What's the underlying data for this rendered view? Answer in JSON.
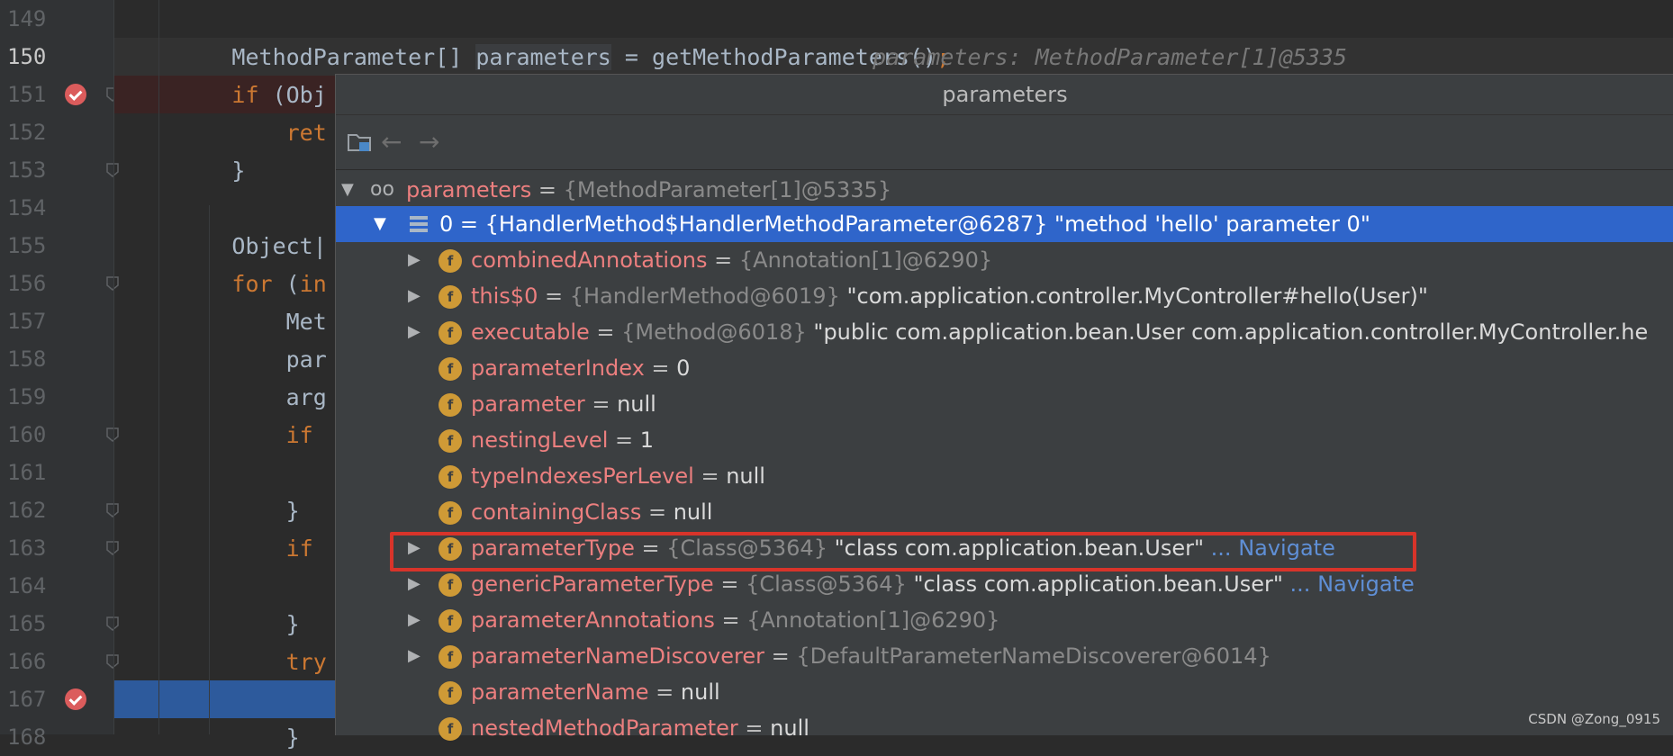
{
  "editor": {
    "lines": [
      {
        "num": "149",
        "code": ""
      },
      {
        "num": "150",
        "code_parts": [
          {
            "t": "        MethodParameter[] ",
            "c": ""
          },
          {
            "t": "parameters",
            "c": "var-hl"
          },
          {
            "t": " = getMethodParameters()",
            "c": ""
          },
          {
            "t": ";",
            "c": "kw"
          }
        ],
        "hint": "  parameters: MethodParameter[1]@5335"
      },
      {
        "num": "151",
        "code_parts": [
          {
            "t": "        ",
            "c": ""
          },
          {
            "t": "if",
            "c": "kw"
          },
          {
            "t": " (Obj",
            "c": ""
          }
        ]
      },
      {
        "num": "152",
        "code_parts": [
          {
            "t": "            ",
            "c": ""
          },
          {
            "t": "ret",
            "c": "kw"
          }
        ]
      },
      {
        "num": "153",
        "code_parts": [
          {
            "t": "        }",
            "c": ""
          }
        ]
      },
      {
        "num": "154",
        "code": ""
      },
      {
        "num": "155",
        "code_parts": [
          {
            "t": "        Object|",
            "c": ""
          }
        ]
      },
      {
        "num": "156",
        "code_parts": [
          {
            "t": "        ",
            "c": ""
          },
          {
            "t": "for",
            "c": "kw"
          },
          {
            "t": " (",
            "c": ""
          },
          {
            "t": "in",
            "c": "kw"
          }
        ]
      },
      {
        "num": "157",
        "code_parts": [
          {
            "t": "            Met",
            "c": ""
          }
        ]
      },
      {
        "num": "158",
        "code_parts": [
          {
            "t": "            par",
            "c": ""
          }
        ]
      },
      {
        "num": "159",
        "code_parts": [
          {
            "t": "            arg",
            "c": ""
          }
        ]
      },
      {
        "num": "160",
        "code_parts": [
          {
            "t": "            ",
            "c": ""
          },
          {
            "t": "if",
            "c": "kw"
          }
        ]
      },
      {
        "num": "161",
        "code": ""
      },
      {
        "num": "162",
        "code_parts": [
          {
            "t": "            }",
            "c": ""
          }
        ]
      },
      {
        "num": "163",
        "code_parts": [
          {
            "t": "            ",
            "c": ""
          },
          {
            "t": "if",
            "c": "kw"
          }
        ]
      },
      {
        "num": "164",
        "code": ""
      },
      {
        "num": "165",
        "code_parts": [
          {
            "t": "            }",
            "c": ""
          }
        ]
      },
      {
        "num": "166",
        "code_parts": [
          {
            "t": "            ",
            "c": ""
          },
          {
            "t": "try",
            "c": "kw"
          }
        ]
      },
      {
        "num": "167",
        "code": ""
      },
      {
        "num": "168",
        "code_parts": [
          {
            "t": "            }",
            "c": ""
          }
        ]
      }
    ]
  },
  "popup": {
    "title": "parameters",
    "toolbar": {
      "watch_icon": "folder-watch-icon",
      "back": "←",
      "forward": "→"
    },
    "root": {
      "name": "parameters",
      "eq": " = ",
      "type": "{MethodParameter[1]@5335}"
    },
    "item0": {
      "text": "0 = {HandlerMethod$HandlerMethodParameter@6287} \"method 'hello' parameter 0\""
    },
    "fields": [
      {
        "name": "combinedAnnotations",
        "type": "{Annotation[1]@6290}",
        "value": "",
        "nav": "",
        "expand": true
      },
      {
        "name": "this$0",
        "type": "{HandlerMethod@6019}",
        "value": " \"com.application.controller.MyController#hello(User)\"",
        "nav": "",
        "expand": true
      },
      {
        "name": "executable",
        "type": "{Method@6018}",
        "value": " \"public com.application.bean.User com.application.controller.MyController.he",
        "nav": "",
        "expand": true
      },
      {
        "name": "parameterIndex",
        "type": "",
        "value": "0",
        "nav": "",
        "expand": false
      },
      {
        "name": "parameter",
        "type": "",
        "value": "null",
        "nav": "",
        "expand": false
      },
      {
        "name": "nestingLevel",
        "type": "",
        "value": "1",
        "nav": "",
        "expand": false
      },
      {
        "name": "typeIndexesPerLevel",
        "type": "",
        "value": "null",
        "nav": "",
        "expand": false
      },
      {
        "name": "containingClass",
        "type": "",
        "value": "null",
        "nav": "",
        "expand": false
      },
      {
        "name": "parameterType",
        "type": "{Class@5364}",
        "value": " \"class com.application.bean.User\"",
        "nav": " ... Navigate",
        "expand": true
      },
      {
        "name": "genericParameterType",
        "type": "{Class@5364}",
        "value": " \"class com.application.bean.User\"",
        "nav": " ... Navigate",
        "expand": true
      },
      {
        "name": "parameterAnnotations",
        "type": "{Annotation[1]@6290}",
        "value": "",
        "nav": "",
        "expand": true
      },
      {
        "name": "parameterNameDiscoverer",
        "type": "{DefaultParameterNameDiscoverer@6014}",
        "value": "",
        "nav": "",
        "expand": true
      },
      {
        "name": "parameterName",
        "type": "",
        "value": "null",
        "nav": "",
        "expand": false
      },
      {
        "name": "nestedMethodParameter",
        "type": "",
        "value": "null",
        "nav": "",
        "expand": false
      }
    ],
    "field_badge": "f",
    "eq": " = "
  },
  "watermark": "CSDN @Zong_0915"
}
